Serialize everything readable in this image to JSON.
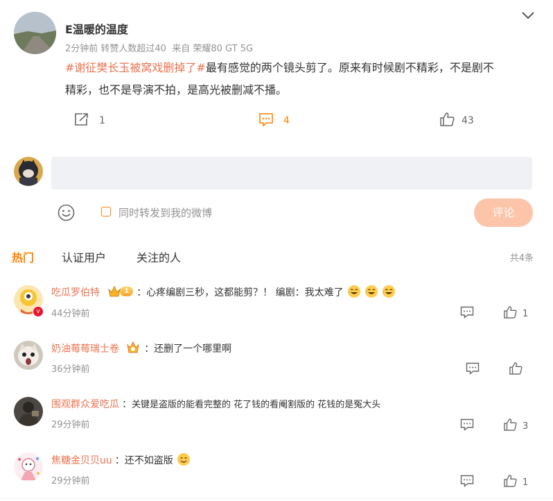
{
  "post": {
    "author": "E温暖的温度",
    "meta": "2分钟前 转赞人数超过40  来自 荣耀80 GT 5G",
    "hashtag": "#谢征樊长玉被窝戏删掉了#",
    "text_part1": "最有感觉的两个镜头剪了。原来有时候剧不精彩，不是剧不",
    "text_part2": "精彩，也不是导演不拍，是高光被删减不播。",
    "repost_count": "1",
    "comment_count": "4",
    "like_count": "43",
    "accent": "#ff8200",
    "link_color": "#eb7350"
  },
  "composer": {
    "input_placeholder": "",
    "repost_label": "同时转发到我的微博",
    "submit_label": "评论",
    "submit_bg": "#fcc4a9"
  },
  "tabs": {
    "hot": "热门",
    "verified": "认证用户",
    "following": "关注的人",
    "total": "共4条"
  },
  "comments": [
    {
      "name": "吃瓜罗伯特",
      "badge_level": "1",
      "sep": "：",
      "text": "心疼编剧三秒，这都能剪？！ 编剧：我太难了",
      "time": "44分钟前",
      "likes": "1"
    },
    {
      "name": "奶油莓莓瑞士卷",
      "sep": "：",
      "text": "还删了一个哪里啊",
      "time": "36分钟前",
      "likes": ""
    },
    {
      "name": "围观群众爱吃瓜",
      "sep": "：",
      "text": "关键是盗版的能看完整的 花了钱的看阉割版的 花钱的是冤大头",
      "time": "29分钟前",
      "likes": "3"
    },
    {
      "name": "焦糖金贝贝uu",
      "sep": "：",
      "text": "还不如盗版",
      "time": "29分钟前",
      "likes": "1"
    }
  ]
}
